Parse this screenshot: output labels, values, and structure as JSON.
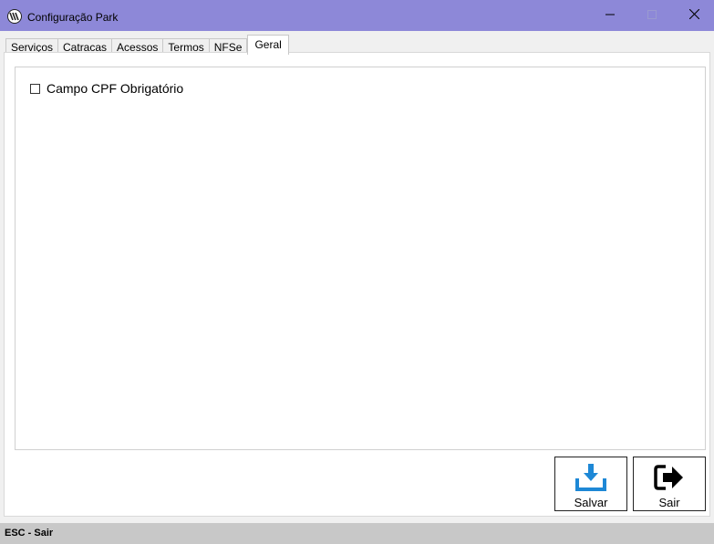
{
  "window": {
    "title": "Configuração Park",
    "title_bar_color": "#8d88d8",
    "icon": "app-logo-icon",
    "controls": [
      "minimize-icon",
      "maximize-icon",
      "close-icon"
    ]
  },
  "tabs": [
    {
      "label": "Serviços",
      "active": false
    },
    {
      "label": "Catracas",
      "active": false
    },
    {
      "label": "Acessos",
      "active": false
    },
    {
      "label": "Termos",
      "active": false
    },
    {
      "label": "NFSe",
      "active": false
    },
    {
      "label": "Geral",
      "active": true
    }
  ],
  "settings": {
    "cpf_required": {
      "label": "Campo CPF Obrigatório",
      "checked": false
    }
  },
  "actions": {
    "save": {
      "label": "Salvar",
      "icon": "save-download-icon",
      "icon_color": "#1e88d6"
    },
    "exit": {
      "label": "Sair",
      "icon": "exit-arrow-icon"
    }
  },
  "status_bar": {
    "text": "ESC - Sair"
  }
}
